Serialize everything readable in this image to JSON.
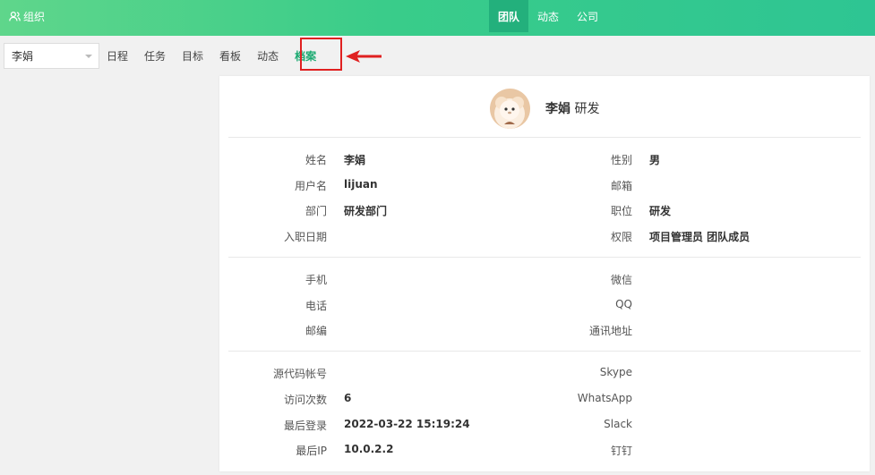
{
  "header": {
    "brand_label": "组织",
    "nav": [
      "团队",
      "动态",
      "公司"
    ],
    "active_nav": 0
  },
  "toolbar": {
    "user_select_value": "李娟",
    "tabs": [
      "日程",
      "任务",
      "目标",
      "看板",
      "动态",
      "档案"
    ],
    "active_tab": 5
  },
  "profile": {
    "name": "李娟",
    "role": "研发"
  },
  "sections": [
    {
      "left": [
        {
          "label": "姓名",
          "value": "李娟"
        },
        {
          "label": "用户名",
          "value": "lijuan"
        },
        {
          "label": "部门",
          "value": "研发部门"
        },
        {
          "label": "入职日期",
          "value": ""
        }
      ],
      "right": [
        {
          "label": "性别",
          "value": "男"
        },
        {
          "label": "邮箱",
          "value": ""
        },
        {
          "label": "职位",
          "value": "研发"
        },
        {
          "label": "权限",
          "value": "项目管理员 团队成员"
        }
      ]
    },
    {
      "left": [
        {
          "label": "手机",
          "value": ""
        },
        {
          "label": "电话",
          "value": ""
        },
        {
          "label": "邮编",
          "value": ""
        }
      ],
      "right": [
        {
          "label": "微信",
          "value": ""
        },
        {
          "label": "QQ",
          "value": ""
        },
        {
          "label": "通讯地址",
          "value": ""
        }
      ]
    },
    {
      "left": [
        {
          "label": "源代码帐号",
          "value": ""
        },
        {
          "label": "访问次数",
          "value": "6"
        },
        {
          "label": "最后登录",
          "value": "2022-03-22 15:19:24"
        },
        {
          "label": "最后IP",
          "value": "10.0.2.2"
        }
      ],
      "right": [
        {
          "label": "Skype",
          "value": ""
        },
        {
          "label": "WhatsApp",
          "value": ""
        },
        {
          "label": "Slack",
          "value": ""
        },
        {
          "label": "钉钉",
          "value": ""
        }
      ]
    }
  ],
  "colors": {
    "header_start": "#5fd68b",
    "header_end": "#2ec593",
    "active_nav_bg": "#23b07c",
    "active_tab_text": "#1aa970",
    "highlight": "#e02020"
  }
}
